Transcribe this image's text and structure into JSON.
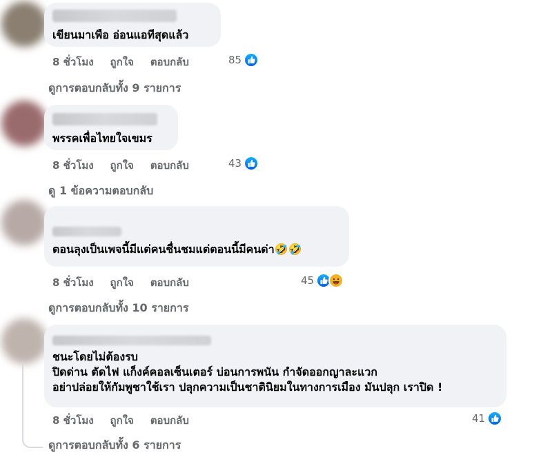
{
  "comments": [
    {
      "text_lines": [
        "เขียนมาเพือ อ่อนแอทีสุดแล้ว"
      ],
      "time": "8 ชั่วโมง",
      "like_label": "ถูกใจ",
      "reply_label": "ตอบกลับ",
      "reaction_count": "85",
      "reactions": [
        "like-icon"
      ],
      "replies_label": "ดูการตอบกลับทั้ง 9 รายการ"
    },
    {
      "text_lines": [
        "พรรคเพื่อไทยใจเขมร"
      ],
      "time": "8 ชั่วโมง",
      "like_label": "ถูกใจ",
      "reply_label": "ตอบกลับ",
      "reaction_count": "43",
      "reactions": [
        "like-icon"
      ],
      "replies_label": "ดู 1 ข้อความตอบกลับ"
    },
    {
      "text_lines": [
        "ตอนลุงเป็นเพจนี้มีแต่คนชื่นชมแต่ตอนนี้มีคนด่า🤣🤣"
      ],
      "time": "8 ชั่วโมง",
      "like_label": "ถูกใจ",
      "reply_label": "ตอบกลับ",
      "reaction_count": "45",
      "reactions": [
        "like-icon",
        "haha-icon"
      ],
      "replies_label": "ดูการตอบกลับทั้ง 10 รายการ"
    },
    {
      "text_lines": [
        "ชนะโดยไม่ต้องรบ",
        "ปิดด่าน ตัดไฟ แก็งค์คอลเซ็นเตอร์ บ่อนการพนัน กำจัดออกญาละแวก",
        "อย่าปล่อยให้กัมพูชาใช้เรา ปลุกความเป็นชาตินิยมในทางการเมือง มันปลุก เราปิด !"
      ],
      "time": "8 ชั่วโมง",
      "like_label": "ถูกใจ",
      "reply_label": "ตอบกลับ",
      "reaction_count": "41",
      "reactions": [
        "like-icon"
      ],
      "replies_label": "ดูการตอบกลับทั้ง 6 รายการ"
    }
  ],
  "colors": {
    "bubble": "#f0f2f5",
    "meta_text": "#65676b",
    "like_blue": "#0866ff",
    "haha_yellow": "#f7b125"
  }
}
